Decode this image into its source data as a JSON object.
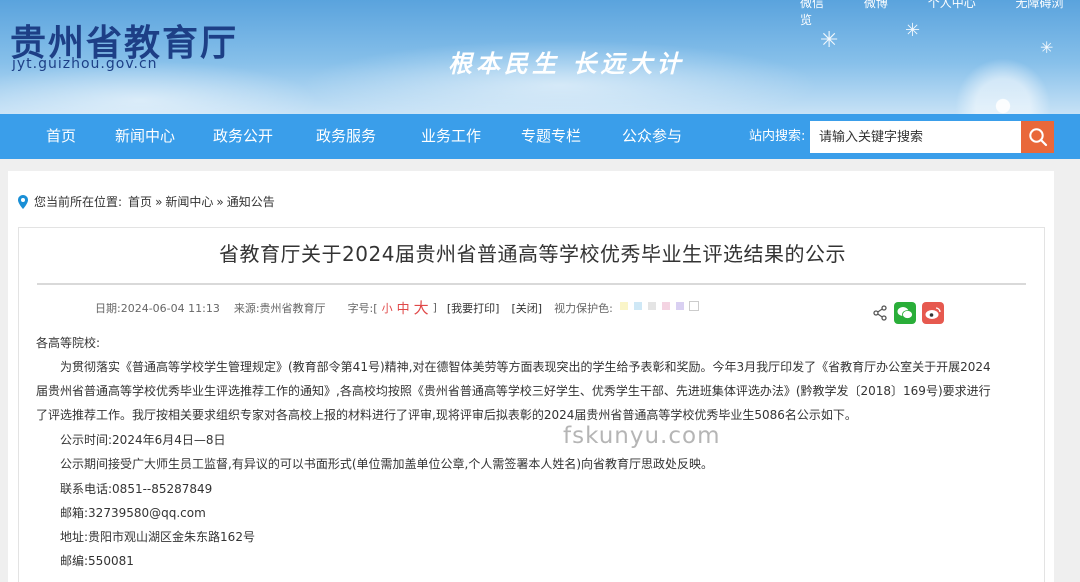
{
  "header": {
    "site_title": "贵州省教育厅",
    "site_domain": "jyt.guizhou.gov.cn",
    "slogan": "根本民生 长远大计",
    "top_links": [
      "微信",
      "微博",
      "个人中心",
      "无障碍浏览"
    ]
  },
  "nav": {
    "items": [
      "首页",
      "新闻中心",
      "政务公开",
      "政务服务",
      "业务工作",
      "专题专栏",
      "公众参与"
    ],
    "search_label": "站内搜索:",
    "search_placeholder": "请输入关键字搜索"
  },
  "breadcrumb": {
    "location_label": "您当前所在位置:",
    "items": [
      "首页",
      "新闻中心",
      "通知公告"
    ],
    "separator": "»"
  },
  "article": {
    "title": "省教育厅关于2024届贵州省普通高等学校优秀毕业生评选结果的公示",
    "meta": {
      "date": "日期:2024-06-04 11:13",
      "source": "来源:贵州省教育厅",
      "font_label": "字号:[",
      "font_small": "小",
      "font_mid": "中",
      "font_big": "大",
      "font_close": "]",
      "print": "[我要打印]",
      "close": "[关闭]",
      "eye_label": "视力保护色:",
      "eye_colors": [
        "#faf5c8",
        "#cfe8f6",
        "#e4e4e4",
        "#f4d4e2",
        "#d9d0f2",
        "#ffffff"
      ]
    },
    "share_icons": [
      "share-icon",
      "wechat-icon",
      "weibo-icon"
    ],
    "salutation": "各高等院校:",
    "para1_line1": "为贯彻落实《普通高等学校学生管理规定》(教育部令第41号)精神,对在德智体美劳等方面表现突出的学生给予表彰和奖励。今年3月我厅印发了《省教育厅办公室关于开展2024",
    "para1_line2": "届贵州省普通高等学校优秀毕业生评选推荐工作的通知》,各高校均按照《贵州省普通高等学校三好学生、优秀学生干部、先进班集体评选办法》(黔教学发〔2018〕169号)要求进行",
    "para1_line3": "了评选推荐工作。我厅按相关要求组织专家对各高校上报的材料进行了评审,现将评审后拟表彰的2024届贵州省普通高等学校优秀毕业生5086名公示如下。",
    "period": "公示时间:2024年6月4日—8日",
    "supervision": "公示期间接受广大师生员工监督,有异议的可以书面形式(单位需加盖单位公章,个人需签署本人姓名)向省教育厅思政处反映。",
    "phone": "联系电话:0851--85287849",
    "email": "邮箱:32739580@qq.com",
    "address": "地址:贵阳市观山湖区金朱东路162号",
    "postcode": "邮编:550081"
  },
  "watermark": "fskunyu.com"
}
